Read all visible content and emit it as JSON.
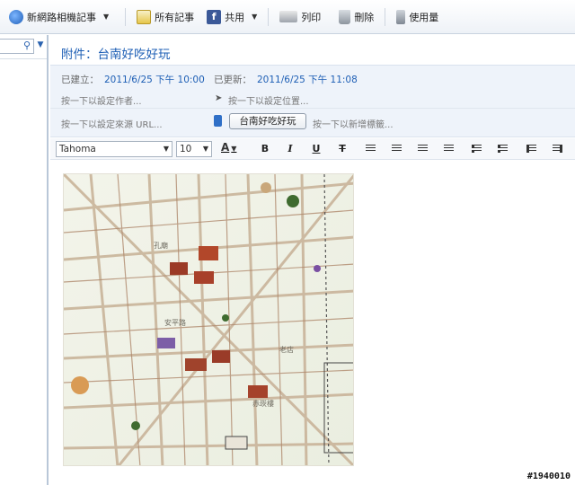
{
  "toolbar": {
    "new_photo_note": "新網路相機記事",
    "all_notes": "所有記事",
    "share": "共用",
    "print": "列印",
    "delete": "刪除",
    "usage": "使用量"
  },
  "note": {
    "title": "附件：台南好吃好玩",
    "created_label": "已建立：",
    "created_value": "2011/6/25 下午 10:00",
    "updated_label": "已更新：",
    "updated_value": "2011/6/25 下午 11:08",
    "author_hint": "按一下以設定作者...",
    "location_hint": "按一下以設定位置...",
    "source_hint": "按一下以設定來源 URL...",
    "notebook_value": "台南好吃好玩",
    "tags_hint": "按一下以新增標籤..."
  },
  "format": {
    "font_value": "Tahoma",
    "size_value": "10",
    "color_glyph": "A",
    "bold": "B",
    "italic": "I",
    "underline": "U",
    "strike": "T"
  },
  "colors": {
    "accent": "#1e5fb5",
    "meta_bg": "#eef3fa"
  },
  "watermark": "#1940010"
}
